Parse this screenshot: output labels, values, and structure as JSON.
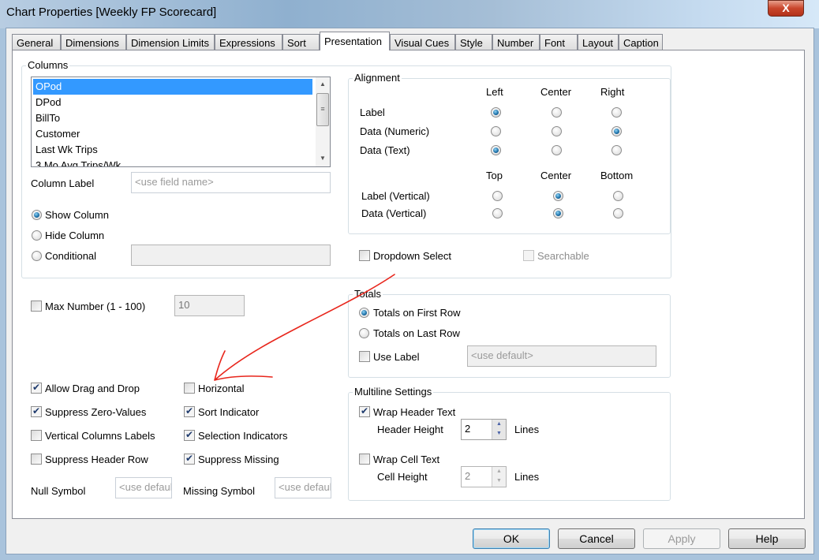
{
  "window": {
    "title": "Chart Properties [Weekly FP Scorecard]",
    "close_label": "X"
  },
  "tabs": [
    {
      "label": "General"
    },
    {
      "label": "Dimensions"
    },
    {
      "label": "Dimension Limits"
    },
    {
      "label": "Expressions"
    },
    {
      "label": "Sort"
    },
    {
      "label": "Presentation",
      "active": true
    },
    {
      "label": "Visual Cues"
    },
    {
      "label": "Style"
    },
    {
      "label": "Number"
    },
    {
      "label": "Font"
    },
    {
      "label": "Layout"
    },
    {
      "label": "Caption"
    }
  ],
  "columns": {
    "legend": "Columns",
    "items": [
      "OPod",
      "DPod",
      "BillTo",
      "Customer",
      "Last Wk Trips",
      "3 Mo Avg Trips/Wk"
    ],
    "selected": "OPod",
    "column_label": "Column Label",
    "column_label_placeholder": "<use field name>",
    "show_column": "Show Column",
    "hide_column": "Hide Column",
    "conditional": "Conditional",
    "visibility": "Show Column"
  },
  "alignment": {
    "legend": "Alignment",
    "h_headers": [
      "Left",
      "Center",
      "Right"
    ],
    "v_headers": [
      "Top",
      "Center",
      "Bottom"
    ],
    "rows": [
      {
        "label": "Label",
        "value": "Left"
      },
      {
        "label": "Data (Numeric)",
        "value": "Right"
      },
      {
        "label": "Data (Text)",
        "value": "Left"
      }
    ],
    "vrows": [
      {
        "label": "Label (Vertical)",
        "value": "Center"
      },
      {
        "label": "Data (Vertical)",
        "value": "Center"
      }
    ]
  },
  "dropdown_select": {
    "label": "Dropdown Select",
    "checked": false
  },
  "searchable": {
    "label": "Searchable",
    "checked": false,
    "disabled": true
  },
  "max_number": {
    "label": "Max Number (1 - 100)",
    "checked": false,
    "value": "10"
  },
  "totals": {
    "legend": "Totals",
    "first_row": "Totals on First Row",
    "last_row": "Totals on Last Row",
    "selected": "Totals on First Row",
    "use_label": "Use Label",
    "use_label_checked": false,
    "label_placeholder": "<use default>"
  },
  "options_left": [
    {
      "label": "Allow Drag and Drop",
      "checked": true
    },
    {
      "label": "Suppress Zero-Values",
      "checked": true
    },
    {
      "label": "Vertical Columns Labels",
      "checked": false
    },
    {
      "label": "Suppress Header Row",
      "checked": false
    }
  ],
  "options_right": [
    {
      "label": "Horizontal",
      "checked": false
    },
    {
      "label": "Sort Indicator",
      "checked": true
    },
    {
      "label": "Selection Indicators",
      "checked": true
    },
    {
      "label": "Suppress Missing",
      "checked": true
    }
  ],
  "null_symbol": {
    "label": "Null Symbol",
    "placeholder": "<use default>"
  },
  "missing_symbol": {
    "label": "Missing Symbol",
    "placeholder": "<use default>"
  },
  "multiline": {
    "legend": "Multiline Settings",
    "wrap_header": "Wrap Header Text",
    "wrap_header_checked": true,
    "header_height": "Header Height",
    "header_value": "2",
    "wrap_cell": "Wrap Cell Text",
    "wrap_cell_checked": false,
    "cell_height": "Cell Height",
    "cell_value": "2",
    "lines": "Lines"
  },
  "buttons": {
    "ok": "OK",
    "cancel": "Cancel",
    "apply": "Apply",
    "help": "Help"
  },
  "annotation": {
    "color": "#e8261c"
  }
}
